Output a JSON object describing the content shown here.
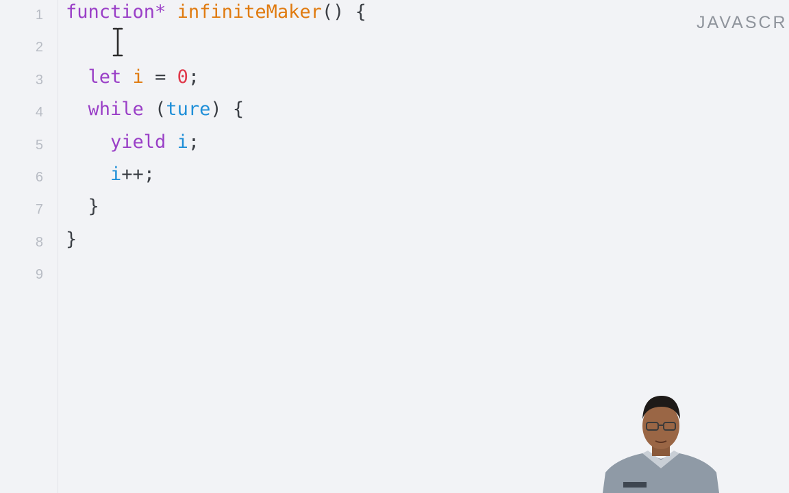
{
  "editor": {
    "language_label": "JAVASCR",
    "lines": [
      {
        "number": "1",
        "tokens": [
          {
            "text": "function*",
            "cls": "kw"
          },
          {
            "text": " ",
            "cls": "punc"
          },
          {
            "text": "infiniteMaker",
            "cls": "fn"
          },
          {
            "text": "() {",
            "cls": "punc"
          }
        ]
      },
      {
        "number": "2",
        "tokens": []
      },
      {
        "number": "3",
        "tokens": [
          {
            "text": "  ",
            "cls": "punc"
          },
          {
            "text": "let",
            "cls": "kw"
          },
          {
            "text": " ",
            "cls": "punc"
          },
          {
            "text": "i",
            "cls": "var"
          },
          {
            "text": " = ",
            "cls": "punc"
          },
          {
            "text": "0",
            "cls": "num"
          },
          {
            "text": ";",
            "cls": "punc"
          }
        ]
      },
      {
        "number": "4",
        "tokens": [
          {
            "text": "  ",
            "cls": "punc"
          },
          {
            "text": "while",
            "cls": "kw"
          },
          {
            "text": " (",
            "cls": "punc"
          },
          {
            "text": "ture",
            "cls": "id"
          },
          {
            "text": ") {",
            "cls": "punc"
          }
        ]
      },
      {
        "number": "5",
        "tokens": [
          {
            "text": "    ",
            "cls": "punc"
          },
          {
            "text": "yield",
            "cls": "kw"
          },
          {
            "text": " ",
            "cls": "punc"
          },
          {
            "text": "i",
            "cls": "id"
          },
          {
            "text": ";",
            "cls": "punc"
          }
        ]
      },
      {
        "number": "6",
        "tokens": [
          {
            "text": "    ",
            "cls": "punc"
          },
          {
            "text": "i",
            "cls": "id"
          },
          {
            "text": "++;",
            "cls": "punc"
          }
        ]
      },
      {
        "number": "7",
        "tokens": [
          {
            "text": "  ",
            "cls": "punc"
          },
          {
            "text": "}",
            "cls": "punc"
          }
        ]
      },
      {
        "number": "8",
        "tokens": [
          {
            "text": "}",
            "cls": "punc"
          }
        ]
      },
      {
        "number": "9",
        "tokens": []
      }
    ]
  },
  "colors": {
    "background": "#f2f3f6",
    "keyword": "#9a3fc7",
    "function_name": "#e07b10",
    "number": "#e0394b",
    "identifier": "#1f8fd8"
  },
  "icons": {
    "cursor": "text-cursor-icon"
  }
}
